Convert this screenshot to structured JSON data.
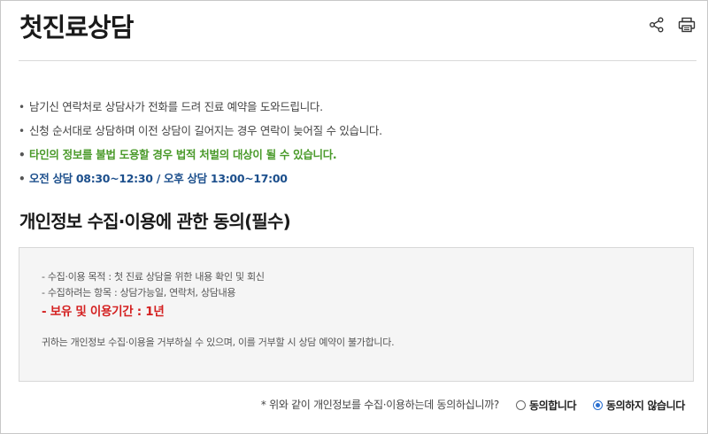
{
  "header": {
    "title": "첫진료상담",
    "share_icon": "share-icon",
    "print_icon": "printer-icon"
  },
  "notices": [
    "남기신 연락처로 상담사가 전화를 드려 진료 예약을 도와드립니다.",
    "신청 순서대로 상담하며 이전 상담이 길어지는 경우 연락이 늦어질 수 있습니다.",
    "타인의 정보를 불법 도용할 경우 법적 처벌의 대상이 될 수 있습니다.",
    "오전 상담 08:30~12:30 / 오후 상담 13:00~17:00"
  ],
  "consent": {
    "heading": "개인정보 수집·이용에 관한 동의(필수)",
    "purpose": "- 수집·이용 목적 : 첫 진료 상담을 위한 내용 확인 및 회신",
    "items": "- 수집하려는 항목 : 상담가능일, 연락처, 상담내용",
    "retention": "- 보유 및 이용기간 : 1년",
    "refusal_note": "귀하는 개인정보 수집·이용을 거부하실 수 있으며, 이를 거부할 시 상담 예약이 불가합니다.",
    "question": "* 위와 같이 개인정보를 수집·이용하는데 동의하십니까?",
    "agree_label": "동의합니다",
    "disagree_label": "동의하지 않습니다",
    "selected": "disagree"
  },
  "colors": {
    "warning_green": "#4a9a2a",
    "hours_blue": "#1c4f8c",
    "retention_red": "#d42020",
    "radio_blue": "#2a6fd0"
  }
}
